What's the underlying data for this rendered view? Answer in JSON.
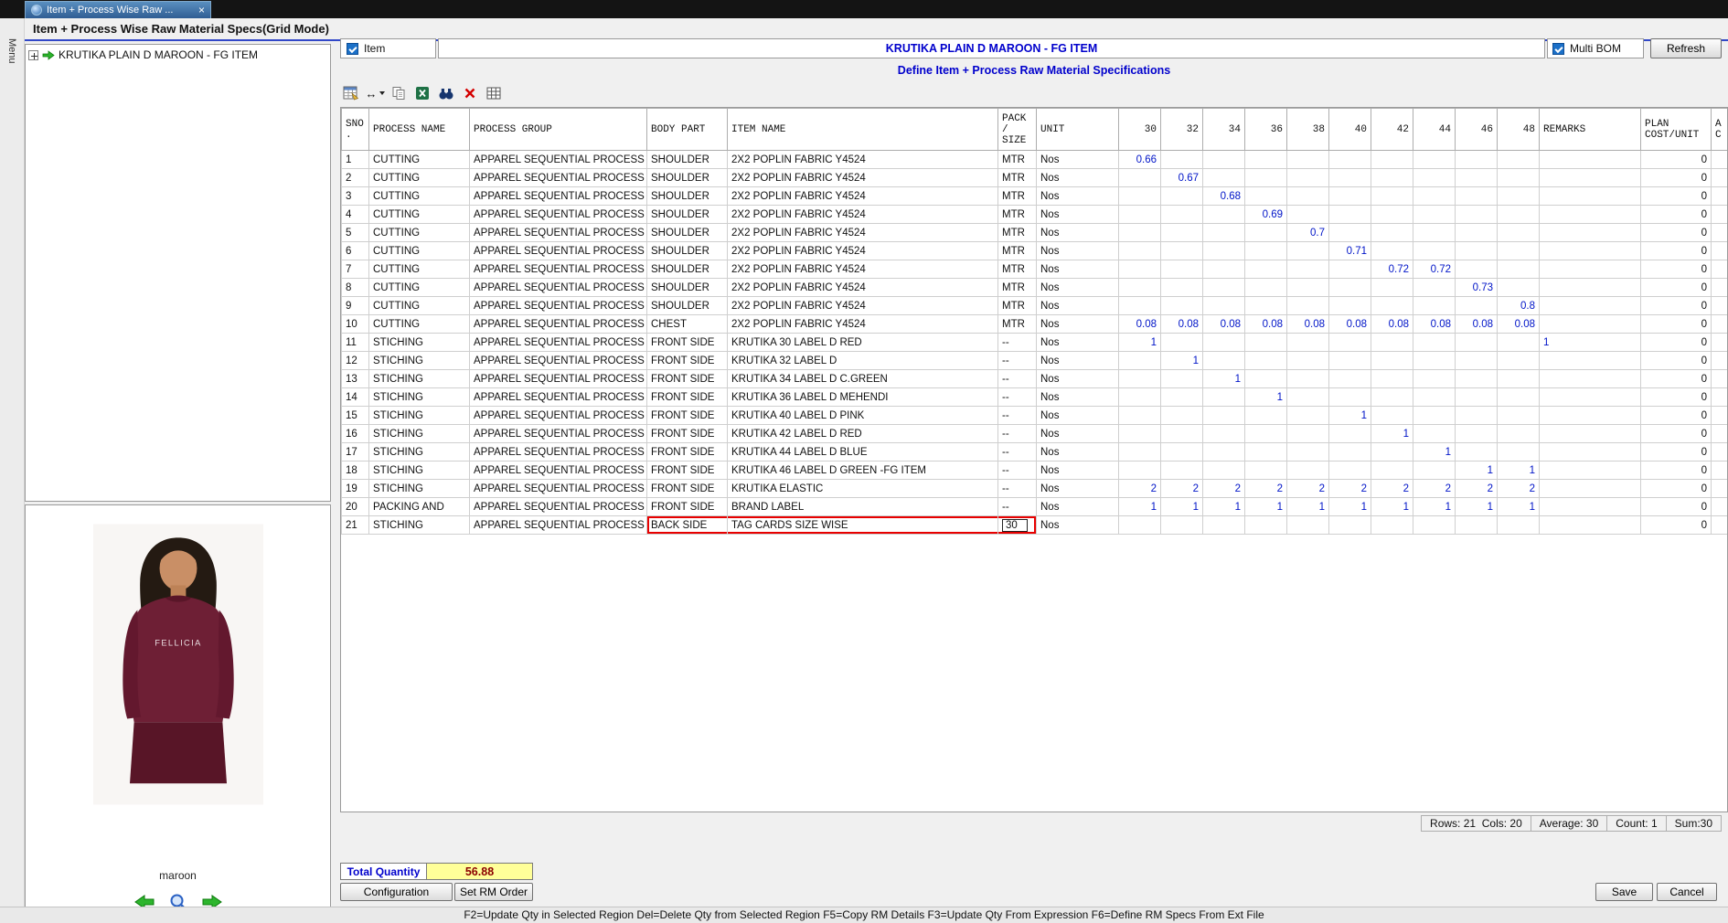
{
  "tab": {
    "label": "Item + Process Wise Raw ...",
    "close": "×"
  },
  "menu_strip_label": "Menu",
  "window_title": "Item + Process Wise Raw Material Specs(Grid Mode)",
  "tree": {
    "root_label": "KRUTIKA PLAIN D MAROON - FG ITEM"
  },
  "preview": {
    "garment_text": "FELLICIA",
    "caption": "maroon"
  },
  "form": {
    "item_label": "Item",
    "item_value": "KRUTIKA PLAIN D MAROON - FG ITEM",
    "multi_bom_label": "Multi BOM",
    "refresh_label": "Refresh"
  },
  "section_title": "Define Item + Process Raw Material Specifications",
  "icons": {
    "fit_width": "↔"
  },
  "grid": {
    "headers": {
      "sno": "SNO\n.",
      "process": "PROCESS NAME",
      "group": "PROCESS GROUP",
      "body": "BODY PART",
      "item": "ITEM NAME",
      "pack": "PACK\n/\nSIZE",
      "unit": "UNIT",
      "remarks": "REMARKS",
      "plan": "PLAN\nCOST/UNIT",
      "extra": "A\nC"
    },
    "size_columns": [
      "30",
      "32",
      "34",
      "36",
      "38",
      "40",
      "42",
      "44",
      "46",
      "48"
    ],
    "highlight": {
      "row_index": 20
    },
    "rows": [
      {
        "sno": "1",
        "process": "CUTTING",
        "group": "APPAREL SEQUENTIAL PROCESS",
        "body": "SHOULDER",
        "item": "2X2 POPLIN FABRIC Y4524",
        "pack": "MTR",
        "unit": "Nos",
        "sizes": [
          "0.66",
          "",
          "",
          "",
          "",
          "",
          "",
          "",
          "",
          ""
        ],
        "remarks": "",
        "plan": "0"
      },
      {
        "sno": "2",
        "process": "CUTTING",
        "group": "APPAREL SEQUENTIAL PROCESS",
        "body": "SHOULDER",
        "item": "2X2 POPLIN FABRIC Y4524",
        "pack": "MTR",
        "unit": "Nos",
        "sizes": [
          "",
          "0.67",
          "",
          "",
          "",
          "",
          "",
          "",
          "",
          ""
        ],
        "remarks": "",
        "plan": "0"
      },
      {
        "sno": "3",
        "process": "CUTTING",
        "group": "APPAREL SEQUENTIAL PROCESS",
        "body": "SHOULDER",
        "item": "2X2 POPLIN FABRIC Y4524",
        "pack": "MTR",
        "unit": "Nos",
        "sizes": [
          "",
          "",
          "0.68",
          "",
          "",
          "",
          "",
          "",
          "",
          ""
        ],
        "remarks": "",
        "plan": "0"
      },
      {
        "sno": "4",
        "process": "CUTTING",
        "group": "APPAREL SEQUENTIAL PROCESS",
        "body": "SHOULDER",
        "item": "2X2 POPLIN FABRIC Y4524",
        "pack": "MTR",
        "unit": "Nos",
        "sizes": [
          "",
          "",
          "",
          "0.69",
          "",
          "",
          "",
          "",
          "",
          ""
        ],
        "remarks": "",
        "plan": "0"
      },
      {
        "sno": "5",
        "process": "CUTTING",
        "group": "APPAREL SEQUENTIAL PROCESS",
        "body": "SHOULDER",
        "item": "2X2 POPLIN FABRIC Y4524",
        "pack": "MTR",
        "unit": "Nos",
        "sizes": [
          "",
          "",
          "",
          "",
          "0.7",
          "",
          "",
          "",
          "",
          ""
        ],
        "remarks": "",
        "plan": "0"
      },
      {
        "sno": "6",
        "process": "CUTTING",
        "group": "APPAREL SEQUENTIAL PROCESS",
        "body": "SHOULDER",
        "item": "2X2 POPLIN FABRIC Y4524",
        "pack": "MTR",
        "unit": "Nos",
        "sizes": [
          "",
          "",
          "",
          "",
          "",
          "0.71",
          "",
          "",
          "",
          ""
        ],
        "remarks": "",
        "plan": "0"
      },
      {
        "sno": "7",
        "process": "CUTTING",
        "group": "APPAREL SEQUENTIAL PROCESS",
        "body": "SHOULDER",
        "item": "2X2 POPLIN FABRIC Y4524",
        "pack": "MTR",
        "unit": "Nos",
        "sizes": [
          "",
          "",
          "",
          "",
          "",
          "",
          "0.72",
          "0.72",
          "",
          ""
        ],
        "remarks": "",
        "plan": "0"
      },
      {
        "sno": "8",
        "process": "CUTTING",
        "group": "APPAREL SEQUENTIAL PROCESS",
        "body": "SHOULDER",
        "item": "2X2 POPLIN FABRIC Y4524",
        "pack": "MTR",
        "unit": "Nos",
        "sizes": [
          "",
          "",
          "",
          "",
          "",
          "",
          "",
          "",
          "0.73",
          ""
        ],
        "remarks": "",
        "plan": "0"
      },
      {
        "sno": "9",
        "process": "CUTTING",
        "group": "APPAREL SEQUENTIAL PROCESS",
        "body": "SHOULDER",
        "item": "2X2 POPLIN FABRIC Y4524",
        "pack": "MTR",
        "unit": "Nos",
        "sizes": [
          "",
          "",
          "",
          "",
          "",
          "",
          "",
          "",
          "",
          "0.8"
        ],
        "remarks": "",
        "plan": "0"
      },
      {
        "sno": "10",
        "process": "CUTTING",
        "group": "APPAREL SEQUENTIAL PROCESS",
        "body": "CHEST",
        "item": "2X2 POPLIN FABRIC Y4524",
        "pack": "MTR",
        "unit": "Nos",
        "sizes": [
          "0.08",
          "0.08",
          "0.08",
          "0.08",
          "0.08",
          "0.08",
          "0.08",
          "0.08",
          "0.08",
          "0.08"
        ],
        "remarks": "",
        "plan": "0"
      },
      {
        "sno": "11",
        "process": "STICHING",
        "group": "APPAREL SEQUENTIAL PROCESS",
        "body": "FRONT SIDE",
        "item": "KRUTIKA 30 LABEL D RED",
        "pack": "--",
        "unit": "Nos",
        "sizes": [
          "1",
          "",
          "",
          "",
          "",
          "",
          "",
          "",
          "",
          ""
        ],
        "remarks": "1",
        "plan": "0"
      },
      {
        "sno": "12",
        "process": "STICHING",
        "group": "APPAREL SEQUENTIAL PROCESS",
        "body": "FRONT SIDE",
        "item": "KRUTIKA 32 LABEL D",
        "pack": "--",
        "unit": "Nos",
        "sizes": [
          "",
          "1",
          "",
          "",
          "",
          "",
          "",
          "",
          "",
          ""
        ],
        "remarks": "",
        "plan": "0"
      },
      {
        "sno": "13",
        "process": "STICHING",
        "group": "APPAREL SEQUENTIAL PROCESS",
        "body": "FRONT SIDE",
        "item": "KRUTIKA 34 LABEL D C.GREEN",
        "pack": "--",
        "unit": "Nos",
        "sizes": [
          "",
          "",
          "1",
          "",
          "",
          "",
          "",
          "",
          "",
          ""
        ],
        "remarks": "",
        "plan": "0"
      },
      {
        "sno": "14",
        "process": "STICHING",
        "group": "APPAREL SEQUENTIAL PROCESS",
        "body": "FRONT SIDE",
        "item": "KRUTIKA 36 LABEL D MEHENDI",
        "pack": "--",
        "unit": "Nos",
        "sizes": [
          "",
          "",
          "",
          "1",
          "",
          "",
          "",
          "",
          "",
          ""
        ],
        "remarks": "",
        "plan": "0"
      },
      {
        "sno": "15",
        "process": "STICHING",
        "group": "APPAREL SEQUENTIAL PROCESS",
        "body": "FRONT SIDE",
        "item": "KRUTIKA 40 LABEL D PINK",
        "pack": "--",
        "unit": "Nos",
        "sizes": [
          "",
          "",
          "",
          "",
          "",
          "1",
          "",
          "",
          "",
          ""
        ],
        "remarks": "",
        "plan": "0"
      },
      {
        "sno": "16",
        "process": "STICHING",
        "group": "APPAREL SEQUENTIAL PROCESS",
        "body": "FRONT SIDE",
        "item": "KRUTIKA 42 LABEL D RED",
        "pack": "--",
        "unit": "Nos",
        "sizes": [
          "",
          "",
          "",
          "",
          "",
          "",
          "1",
          "",
          "",
          ""
        ],
        "remarks": "",
        "plan": "0"
      },
      {
        "sno": "17",
        "process": "STICHING",
        "group": "APPAREL SEQUENTIAL PROCESS",
        "body": "FRONT SIDE",
        "item": "KRUTIKA 44 LABEL D BLUE",
        "pack": "--",
        "unit": "Nos",
        "sizes": [
          "",
          "",
          "",
          "",
          "",
          "",
          "",
          "1",
          "",
          ""
        ],
        "remarks": "",
        "plan": "0"
      },
      {
        "sno": "18",
        "process": "STICHING",
        "group": "APPAREL SEQUENTIAL PROCESS",
        "body": "FRONT SIDE",
        "item": "KRUTIKA 46 LABEL D GREEN -FG ITEM",
        "pack": "--",
        "unit": "Nos",
        "sizes": [
          "",
          "",
          "",
          "",
          "",
          "",
          "",
          "",
          "1",
          "1"
        ],
        "remarks": "",
        "plan": "0"
      },
      {
        "sno": "19",
        "process": "STICHING",
        "group": "APPAREL SEQUENTIAL PROCESS",
        "body": "FRONT SIDE",
        "item": "KRUTIKA ELASTIC",
        "pack": "--",
        "unit": "Nos",
        "sizes": [
          "2",
          "2",
          "2",
          "2",
          "2",
          "2",
          "2",
          "2",
          "2",
          "2"
        ],
        "remarks": "",
        "plan": "0"
      },
      {
        "sno": "20",
        "process": "PACKING AND",
        "group": "APPAREL SEQUENTIAL PROCESS",
        "body": "FRONT SIDE",
        "item": "BRAND LABEL",
        "pack": "--",
        "unit": "Nos",
        "sizes": [
          "1",
          "1",
          "1",
          "1",
          "1",
          "1",
          "1",
          "1",
          "1",
          "1"
        ],
        "remarks": "",
        "plan": "0"
      },
      {
        "sno": "21",
        "process": "STICHING",
        "group": "APPAREL SEQUENTIAL PROCESS",
        "body": "BACK SIDE",
        "item": "TAG CARDS SIZE WISE",
        "pack": "30",
        "unit": "Nos",
        "sizes": [
          "",
          "",
          "",
          "",
          "",
          "",
          "",
          "",
          "",
          ""
        ],
        "remarks": "",
        "plan": "0"
      }
    ]
  },
  "stats": {
    "rows_cols": "Rows: 21  Cols: 20",
    "average": "Average: 30",
    "count": "Count: 1",
    "sum": "Sum:30"
  },
  "totals": {
    "label": "Total Quantity",
    "value": "56.88"
  },
  "buttons": {
    "configuration": "Configuration",
    "set_rm_order": "Set RM Order",
    "save": "Save",
    "cancel": "Cancel"
  },
  "help_text": "F2=Update Qty in Selected Region  Del=Delete Qty from Selected Region  F5=Copy RM Details  F3=Update Qty From Expression  F6=Define RM Specs From Ext File"
}
